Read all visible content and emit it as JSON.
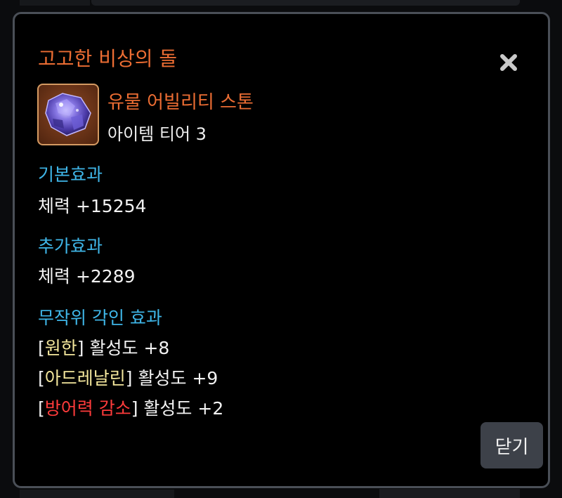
{
  "dialog": {
    "title": "고고한 비상의 돌",
    "close_icon": "close-icon",
    "item": {
      "icon": "purple-crystal-stone-icon",
      "category": "유물 어빌리티 스톤",
      "tier": "아이템 티어 3"
    },
    "basic_effect": {
      "header": "기본효과",
      "stat": "체력 +15254"
    },
    "additional_effect": {
      "header": "추가효과",
      "stat": "체력 +2289"
    },
    "random_engraving": {
      "header": "무작위 각인 효과",
      "items": [
        {
          "open": "[",
          "name": "원한",
          "close": "]",
          "value": " 활성도 +8",
          "name_color": "#f3e69c"
        },
        {
          "open": "[",
          "name": "아드레날린",
          "close": "]",
          "value": " 활성도 +9",
          "name_color": "#f3e69c"
        },
        {
          "open": "[",
          "name": "방어력 감소",
          "close": "]",
          "value": " 활성도 +2",
          "name_color": "#ff3b3b"
        }
      ]
    },
    "close_button_label": "닫기"
  },
  "colors": {
    "title": "#ec6d33",
    "section_header": "#3fb6e8",
    "positive_engraving": "#f3e69c",
    "negative_engraving": "#ff3b3b",
    "dialog_border": "#4a4f57",
    "button_bg": "#3d4149"
  }
}
